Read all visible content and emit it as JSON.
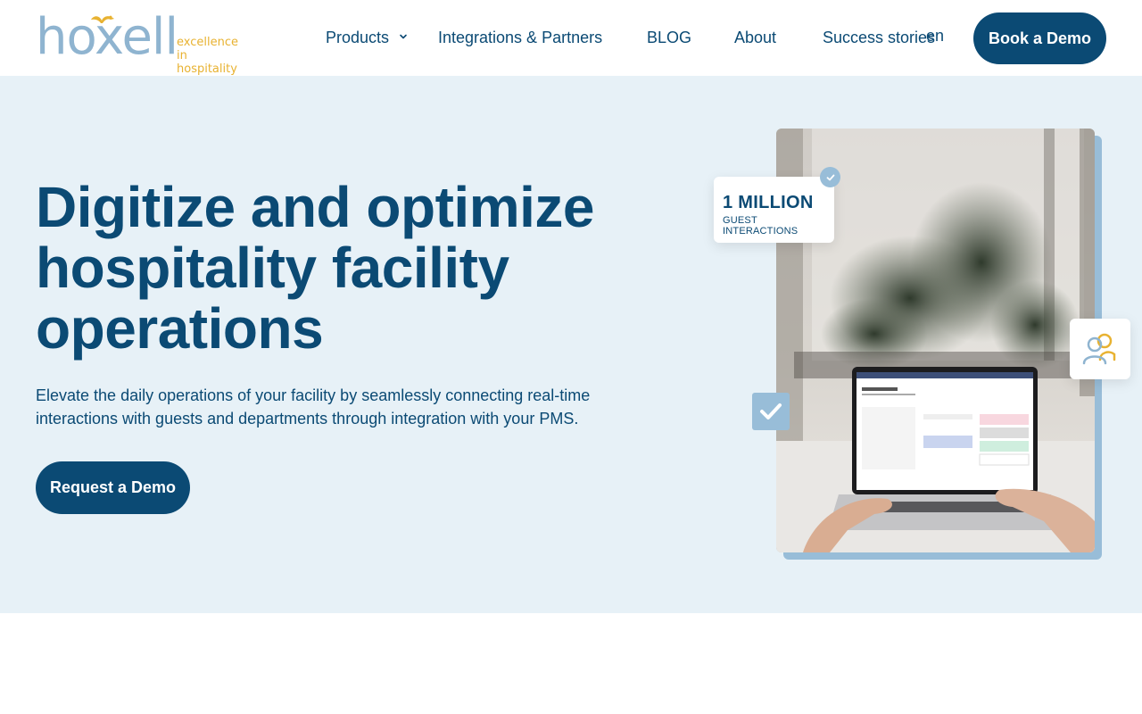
{
  "brand": {
    "name": "hoxell",
    "tagline_line1": "excellence",
    "tagline_line2": "in hospitality",
    "primary_color": "#0b4a74",
    "accent_color": "#e8b231",
    "light_blue": "#98bdd8",
    "hero_bg": "#e7f1f7"
  },
  "nav": {
    "items": [
      {
        "label": "Products",
        "has_dropdown": true,
        "icon": "chevron-down-icon"
      },
      {
        "label": "Integrations & Partners"
      },
      {
        "label": "BLOG"
      },
      {
        "label": "About"
      },
      {
        "label": "Success stories"
      }
    ],
    "language": "en",
    "cta_label": "Book a Demo"
  },
  "hero": {
    "title": "Digitize and optimize hospitality facility operations",
    "subtitle": "Elevate the daily operations of your facility by seamlessly connecting real-time interactions with guests and departments through integration with your PMS.",
    "cta_label": "Request a Demo",
    "stat": {
      "value": "1 MILLION",
      "label": "GUEST INTERACTIONS"
    },
    "icons": [
      "check-circle-icon",
      "users-icon",
      "check-square-icon"
    ]
  }
}
